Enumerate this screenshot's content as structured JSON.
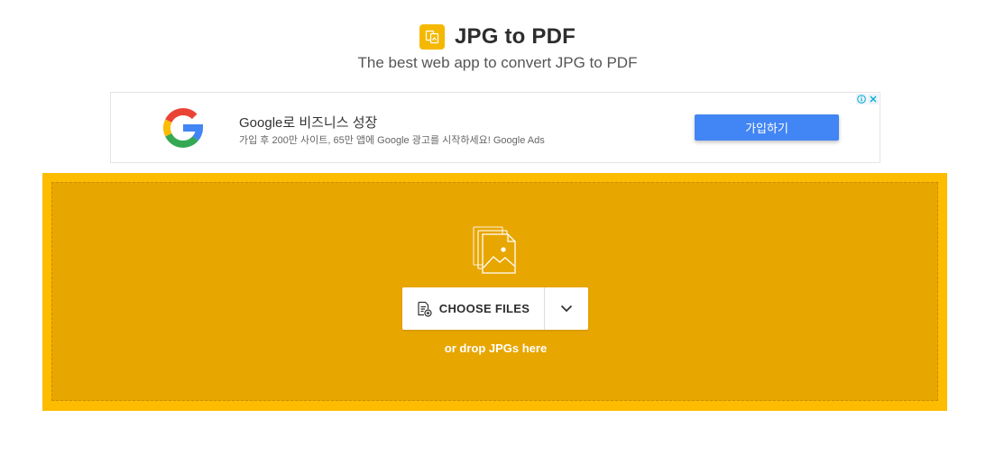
{
  "header": {
    "logo_icon": "jpg-to-pdf-logo-icon",
    "title": "JPG to PDF",
    "tagline": "The best web app to convert JPG to PDF"
  },
  "ad": {
    "logo_icon": "google-g-logo-icon",
    "headline": "Google로 비즈니스 성장",
    "description": "가입 후 200만 사이트, 65만 앱에 Google 광고를 시작하세요! Google Ads",
    "cta_label": "가입하기",
    "info_icon": "ad-info-icon",
    "close_icon": "ad-close-icon"
  },
  "upload": {
    "illustration_icon": "image-files-icon",
    "choose_icon": "add-file-icon",
    "choose_label": "CHOOSE FILES",
    "dropdown_icon": "chevron-down-icon",
    "drop_hint": "or drop JPGs here"
  },
  "colors": {
    "brand_yellow": "#fdbc00",
    "drop_zone": "#e8a600",
    "ad_button": "#4285f4"
  }
}
